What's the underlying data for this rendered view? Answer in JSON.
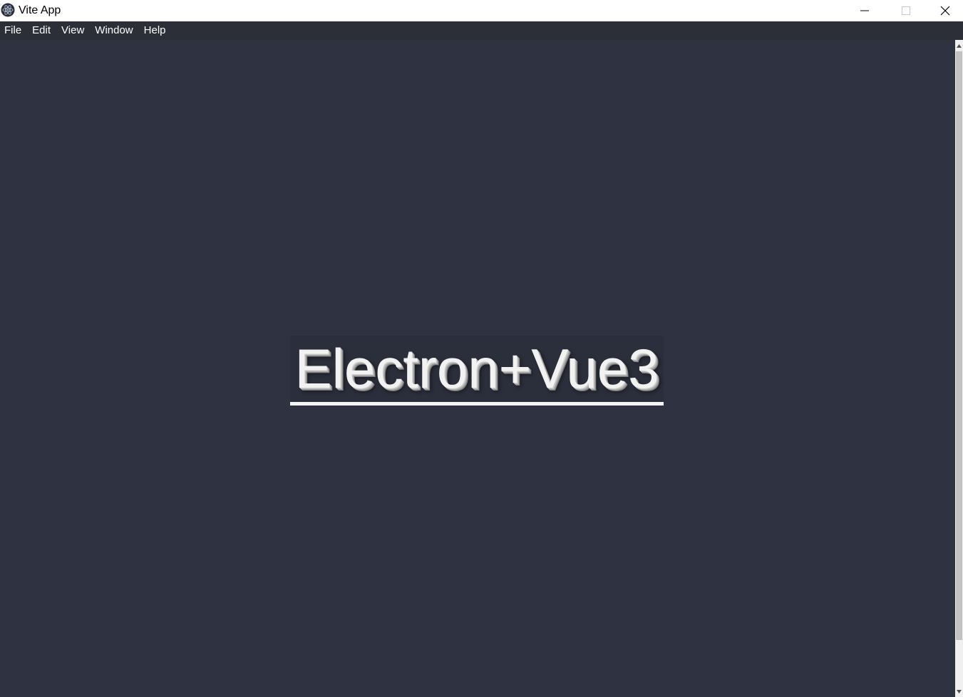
{
  "window": {
    "title": "Vite App",
    "app_icon": "electron-logo-icon",
    "controls": {
      "minimize_icon": "minimize-icon",
      "maximize_icon": "maximize-icon",
      "close_icon": "close-icon"
    }
  },
  "menubar": {
    "items": [
      {
        "label": "File"
      },
      {
        "label": "Edit"
      },
      {
        "label": "View"
      },
      {
        "label": "Window"
      },
      {
        "label": "Help"
      }
    ]
  },
  "main": {
    "heading": "Electron+Vue3"
  },
  "colors": {
    "menubar_bg": "#2c2f38",
    "content_bg": "#2f3241",
    "heading_text": "#f2f2f2"
  }
}
